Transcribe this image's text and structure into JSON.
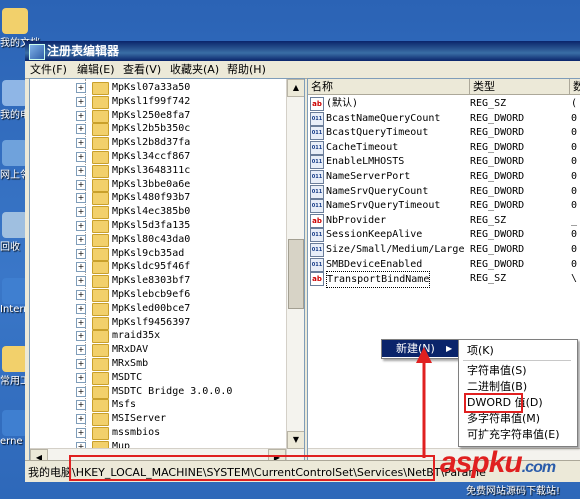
{
  "desktop": {
    "icons": [
      {
        "label": "我的文档",
        "icon": "my-documents-icon"
      },
      {
        "label": "我的电",
        "icon": "my-computer-icon"
      },
      {
        "label": "网上邻",
        "icon": "network-icon"
      },
      {
        "label": "回收",
        "icon": "recycle-bin-icon"
      },
      {
        "label": "Intern Explo",
        "icon": "internet-explorer-icon"
      },
      {
        "label": "常用工",
        "icon": "folder-icon"
      },
      {
        "label": "erne",
        "icon": "internet-icon"
      }
    ]
  },
  "window": {
    "title": "注册表编辑器",
    "menu": [
      "文件(F)",
      "编辑(E)",
      "查看(V)",
      "收藏夹(A)",
      "帮助(H)"
    ]
  },
  "tree": {
    "items": [
      "MpKsl07a33a50",
      "MpKsl1f99f742",
      "MpKsl250e8fa7",
      "MpKsl2b5b350c",
      "MpKsl2b8d37fa",
      "MpKsl34ccf867",
      "MpKsl3648311c",
      "MpKsl3bbe0a6e",
      "MpKsl480f93b7",
      "MpKsl4ec385b0",
      "MpKsl5d3fa135",
      "MpKsl80c43da0",
      "MpKsl9cb35ad",
      "MpKsldc95f46f",
      "MpKsle8303bf7",
      "MpKslebcb9ef6",
      "MpKsled00bce7",
      "MpKslf9456397",
      "mraid35x",
      "MRxDAV",
      "MRxSmb",
      "MSDTC",
      "MSDTC Bridge 3.0.0.0",
      "Msfs",
      "MSIServer",
      "mssmbios",
      "Mup"
    ]
  },
  "values": {
    "headers": {
      "name": "名称",
      "type": "类型",
      "data": "数"
    },
    "rows": [
      {
        "name": "(默认)",
        "type": "REG_SZ",
        "data": "(",
        "kind": "ab"
      },
      {
        "name": "BcastNameQueryCount",
        "type": "REG_DWORD",
        "data": "0",
        "kind": "dw"
      },
      {
        "name": "BcastQueryTimeout",
        "type": "REG_DWORD",
        "data": "0",
        "kind": "dw"
      },
      {
        "name": "CacheTimeout",
        "type": "REG_DWORD",
        "data": "0",
        "kind": "dw"
      },
      {
        "name": "EnableLMHOSTS",
        "type": "REG_DWORD",
        "data": "0",
        "kind": "dw"
      },
      {
        "name": "NameServerPort",
        "type": "REG_DWORD",
        "data": "0",
        "kind": "dw"
      },
      {
        "name": "NameSrvQueryCount",
        "type": "REG_DWORD",
        "data": "0",
        "kind": "dw"
      },
      {
        "name": "NameSrvQueryTimeout",
        "type": "REG_DWORD",
        "data": "0",
        "kind": "dw"
      },
      {
        "name": "NbProvider",
        "type": "REG_SZ",
        "data": "_",
        "kind": "ab"
      },
      {
        "name": "SessionKeepAlive",
        "type": "REG_DWORD",
        "data": "0",
        "kind": "dw"
      },
      {
        "name": "Size/Small/Medium/Large",
        "type": "REG_DWORD",
        "data": "0",
        "kind": "dw"
      },
      {
        "name": "SMBDeviceEnabled",
        "type": "REG_DWORD",
        "data": "0",
        "kind": "dw"
      },
      {
        "name": "TransportBindName",
        "type": "REG_SZ",
        "data": "\\",
        "kind": "ab"
      }
    ]
  },
  "context_menu": {
    "new_label": "新建(N)",
    "submenu": [
      "项(K)",
      "字符串值(S)",
      "二进制值(B)",
      "DWORD 值(D)",
      "多字符串值(M)",
      "可扩充字符串值(E)"
    ]
  },
  "statusbar": {
    "prefix": "我的电脑",
    "path": "\\HKEY_LOCAL_MACHINE\\SYSTEM\\CurrentControlSet\\Services\\NetBT\\Parame"
  },
  "watermark": {
    "brand": "aspku",
    "domain": ".com",
    "slogan": "免费网站源码下载站!"
  },
  "colors": {
    "highlight": "#e02020",
    "titlebar": "#0a246a"
  }
}
